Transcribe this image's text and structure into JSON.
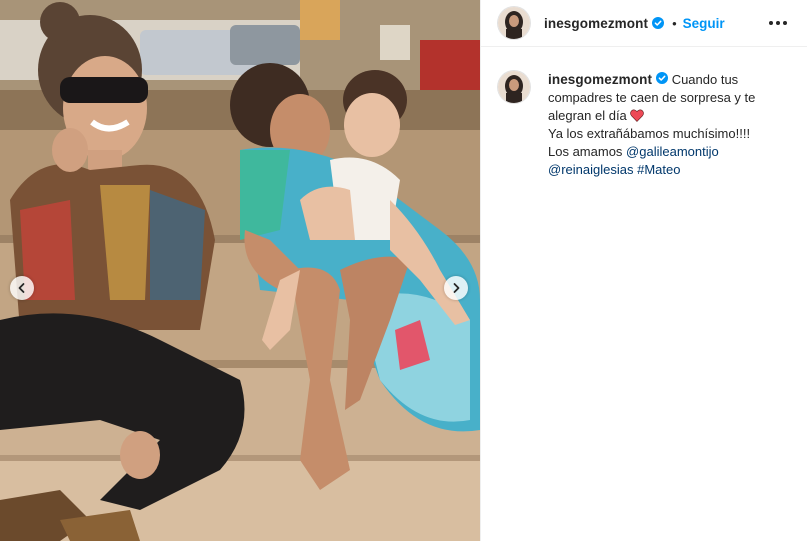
{
  "post": {
    "username": "inesgomezmont",
    "separator": "•",
    "follow_label": "Seguir",
    "verified_icon": "verified-badge-icon",
    "colors": {
      "accent": "#0095f6",
      "link": "#00376b",
      "text": "#262626",
      "heart": "#ed4956"
    }
  },
  "caption": {
    "username": "inesgomezmont",
    "line1": "Cuando tus compadres te caen de sorpresa y te alegran el día",
    "line2": "Ya los extrañábamos muchísimo!!!!",
    "line3_prefix": "Los amamos",
    "mention1": "@galileamontijo",
    "mention2": "@reinaiglesias",
    "hashtag": "#Mateo"
  },
  "media": {
    "prev_icon": "chevron-left-icon",
    "next_icon": "chevron-right-icon"
  }
}
